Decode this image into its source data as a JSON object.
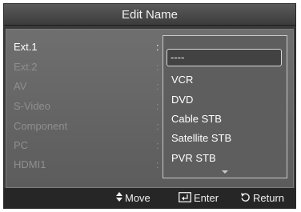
{
  "title": "Edit Name",
  "inputs": [
    {
      "label": "Ext.1",
      "state": "active"
    },
    {
      "label": "Ext.2",
      "state": "dim"
    },
    {
      "label": "AV",
      "state": "dim"
    },
    {
      "label": "S-Video",
      "state": "dim"
    },
    {
      "label": "Component",
      "state": "dim"
    },
    {
      "label": "PC",
      "state": "dim"
    },
    {
      "label": "HDMI1",
      "state": "dim"
    }
  ],
  "separator": ":",
  "dropdown": {
    "selected_value": "----",
    "options": [
      "VCR",
      "DVD",
      "Cable STB",
      "Satellite STB",
      "PVR STB"
    ],
    "scroll_indicator": "chevron-down-icon"
  },
  "footer": {
    "move": {
      "icon": "up-down-arrows-icon",
      "label": "Move"
    },
    "enter": {
      "icon": "enter-icon",
      "label": "Enter"
    },
    "return": {
      "icon": "return-icon",
      "label": "Return"
    }
  },
  "colors": {
    "background": "#3a3a3a",
    "panel": "#666666",
    "active_text": "#ffffff",
    "dim_text": "#8f8f8f",
    "footer": "#262626"
  }
}
